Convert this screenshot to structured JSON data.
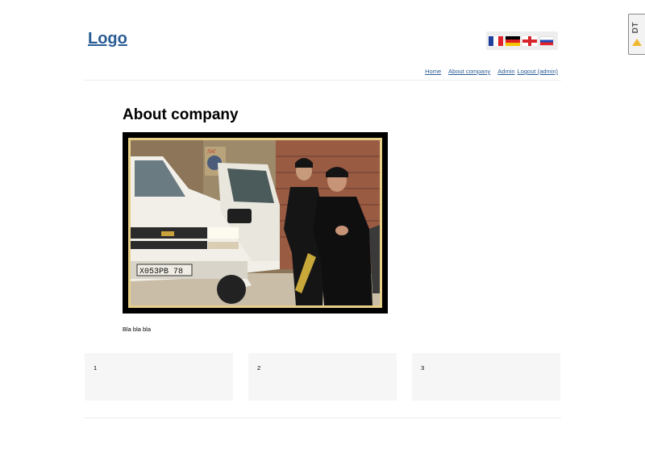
{
  "header": {
    "logo_text": "Logo",
    "languages": [
      "French",
      "German",
      "English",
      "Russian"
    ]
  },
  "nav": {
    "home": "Home",
    "about": "About company",
    "admin": "Admin",
    "logout": "Logout (admin)"
  },
  "main": {
    "title": "About company",
    "photo": {
      "plate_text": "X053PB 78",
      "sign_text": "ЛАГ"
    },
    "body": "Bla bla bla"
  },
  "cards": [
    {
      "label": "1"
    },
    {
      "label": "2"
    },
    {
      "label": "3"
    }
  ],
  "debug_toolbar": {
    "label": "DT"
  }
}
